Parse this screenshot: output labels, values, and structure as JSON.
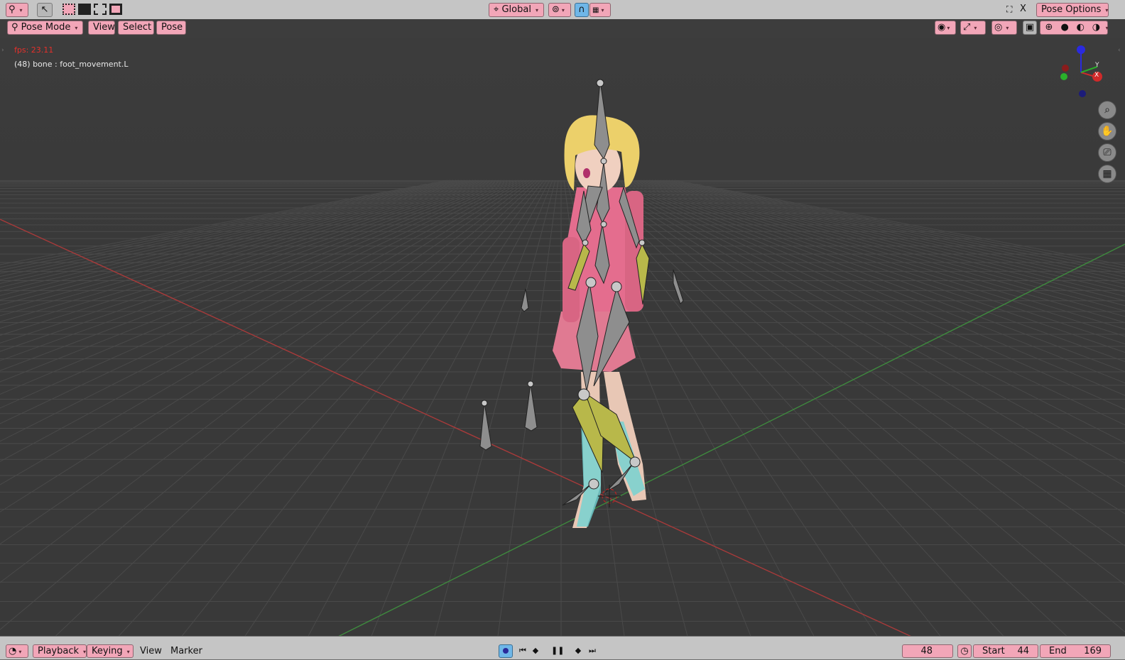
{
  "top_header": {
    "orientation": "Global",
    "pose_options": "Pose Options",
    "close_x": "X"
  },
  "view_header": {
    "mode": "Pose Mode",
    "menus": [
      "View",
      "Select",
      "Pose"
    ]
  },
  "viewport": {
    "fps": "fps: 23.11",
    "active_info": "(48) bone : foot_movement.L",
    "colors": {
      "grid": "#4a4a4a",
      "x_axis": "#a83a3a",
      "y_axis": "#3e8a3e",
      "bone": "#8e8e8e",
      "bone_selected": "#b8b84a",
      "background": "#393939"
    },
    "gizmo": {
      "y": "Y",
      "x": "X"
    },
    "nav_icons": [
      "zoom-icon",
      "hand-icon",
      "camera-icon",
      "grid-icon"
    ]
  },
  "timeline": {
    "menus": [
      "Playback",
      "Keying",
      "View",
      "Marker"
    ],
    "current_frame": "48",
    "start_label": "Start",
    "start_value": "44",
    "end_label": "End",
    "end_value": "169"
  }
}
